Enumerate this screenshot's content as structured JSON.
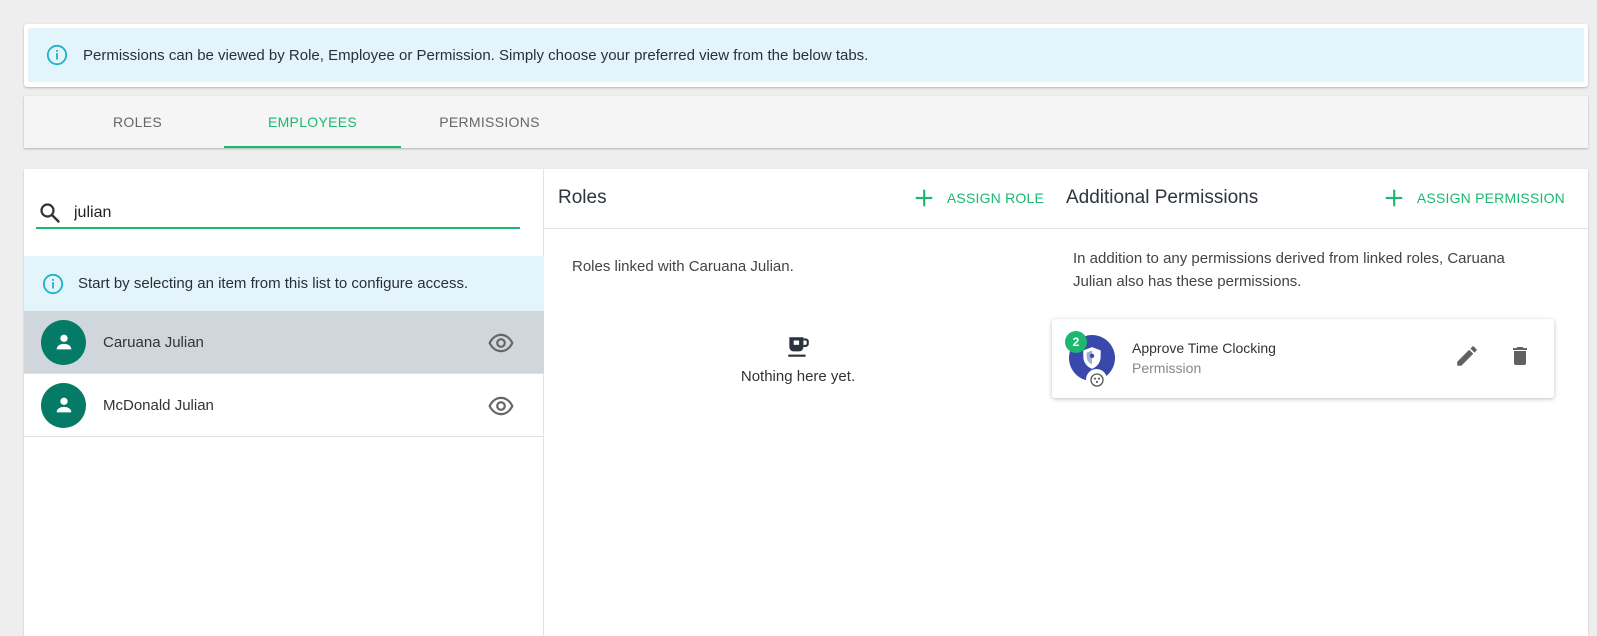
{
  "banner": {
    "text": "Permissions can be viewed by Role, Employee or Permission. Simply choose your preferred view from the below tabs.",
    "icon": "info-icon"
  },
  "tabs": [
    {
      "label": "ROLES",
      "active": false
    },
    {
      "label": "EMPLOYEES",
      "active": true
    },
    {
      "label": "PERMISSIONS",
      "active": false
    }
  ],
  "search": {
    "value": "julian",
    "icon": "search-icon"
  },
  "hint": {
    "text": "Start by selecting an item from this list to configure access."
  },
  "employees": [
    {
      "name": "Caruana Julian",
      "selected": true
    },
    {
      "name": "McDonald Julian",
      "selected": false
    }
  ],
  "roles_panel": {
    "title": "Roles",
    "action": "ASSIGN ROLE",
    "description": "Roles linked with Caruana Julian.",
    "empty_text": "Nothing here yet."
  },
  "permissions_panel": {
    "title": "Additional Permissions",
    "action": "ASSIGN PERMISSION",
    "description": "In addition to any permissions derived from linked roles, Caruana Julian also has these permissions.",
    "items": [
      {
        "badge": "2",
        "name": "Approve Time Clocking",
        "type": "Permission"
      }
    ]
  },
  "colors": {
    "accent": "#1db86f",
    "avatar": "#047a67",
    "permission_icon": "#3949ab",
    "info_bg": "#e3f5fa",
    "selected_row": "#d0d7dc"
  }
}
